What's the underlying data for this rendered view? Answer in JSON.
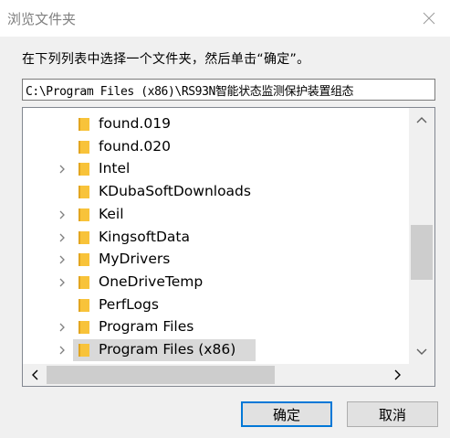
{
  "window": {
    "title": "浏览文件夹",
    "close_icon": "close-icon"
  },
  "instruction": "在下列列表中选择一个文件夹，然后单击“确定”。",
  "path_field": {
    "value": "C:\\Program Files (x86)\\RS93N智能状态监测保护装置组态"
  },
  "tree": {
    "items": [
      {
        "label": "found.019",
        "expandable": false,
        "selected": false
      },
      {
        "label": "found.020",
        "expandable": false,
        "selected": false
      },
      {
        "label": "Intel",
        "expandable": true,
        "selected": false
      },
      {
        "label": "KDubaSoftDownloads",
        "expandable": false,
        "selected": false
      },
      {
        "label": "Keil",
        "expandable": true,
        "selected": false
      },
      {
        "label": "KingsoftData",
        "expandable": true,
        "selected": false
      },
      {
        "label": "MyDrivers",
        "expandable": true,
        "selected": false
      },
      {
        "label": "OneDriveTemp",
        "expandable": true,
        "selected": false
      },
      {
        "label": "PerfLogs",
        "expandable": false,
        "selected": false
      },
      {
        "label": "Program Files",
        "expandable": true,
        "selected": false
      },
      {
        "label": "Program Files (x86)",
        "expandable": true,
        "selected": true
      }
    ],
    "colors": {
      "folder": "#f8c33a",
      "folder_dark": "#e2a51f",
      "selection": "#d9d9d9"
    }
  },
  "buttons": {
    "ok": "确定",
    "cancel": "取消"
  }
}
